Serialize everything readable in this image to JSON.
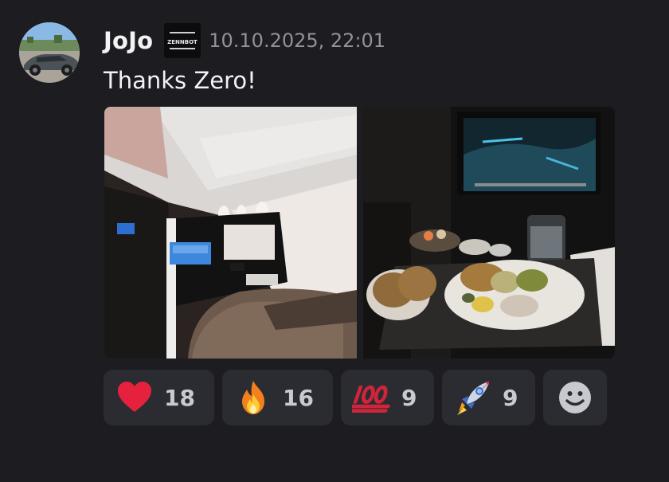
{
  "message": {
    "author": "JoJo",
    "server_tag": "ZENNBOT",
    "timestamp": "10.10.2025, 22:01",
    "text": "Thanks Zero!"
  },
  "attachments": [
    {
      "icon": "airplane-cabin-photo"
    },
    {
      "icon": "inflight-meal-photo"
    }
  ],
  "reactions": [
    {
      "icon": "red-heart",
      "count": "18"
    },
    {
      "icon": "fire",
      "count": "16"
    },
    {
      "icon": "hundred-points",
      "count": "9"
    },
    {
      "icon": "rocket",
      "count": "9"
    }
  ],
  "add_reaction_icon": "smiley-face",
  "colors": {
    "background": "#1c1c21",
    "reaction_bg": "#2b2c32",
    "username": "#f2f3f5",
    "timestamp": "#91929a"
  }
}
